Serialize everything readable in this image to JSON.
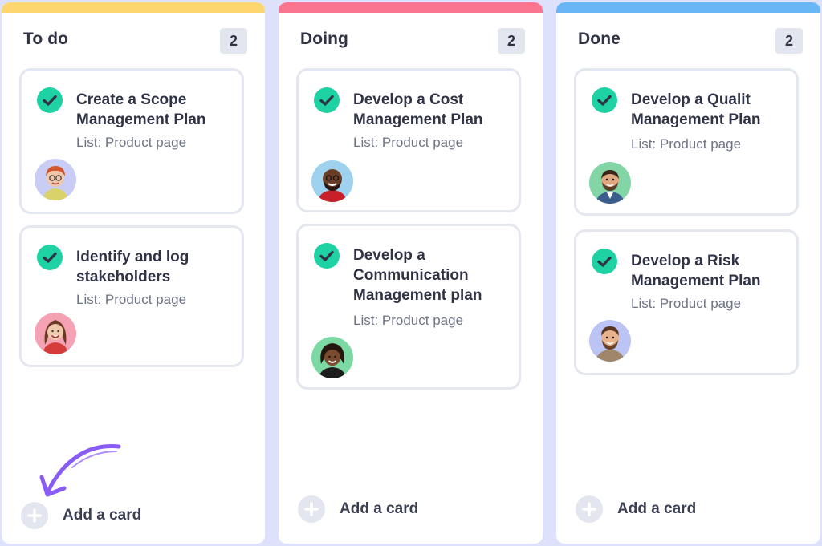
{
  "colors": {
    "todo_bar": "#fdd66f",
    "doing_bar": "#f9758f",
    "done_bar": "#68b6f6",
    "check_green": "#1ed2a4",
    "arrow_purple": "#8a5cf6"
  },
  "columns": [
    {
      "title": "To do",
      "count": "2",
      "add_label": "Add a card",
      "cards": [
        {
          "title": "Create a Scope Management Plan",
          "list": "List: Product page",
          "avatar": "avatar-red-hair-woman"
        },
        {
          "title": "Identify and log stakeholders",
          "list": "List: Product page",
          "avatar": "avatar-brown-hair-woman"
        }
      ]
    },
    {
      "title": "Doing",
      "count": "2",
      "add_label": "Add a card",
      "cards": [
        {
          "title": "Develop a Cost Management Plan",
          "list": "List: Product page",
          "avatar": "avatar-bearded-man"
        },
        {
          "title": "Develop a Communication Management plan",
          "list": "List: Product page",
          "avatar": "avatar-curly-hair-woman"
        }
      ]
    },
    {
      "title": "Done",
      "count": "2",
      "add_label": "Add a card",
      "cards": [
        {
          "title": "Develop a Qualit Management Plan",
          "list": "List: Product page",
          "avatar": "avatar-smiling-man"
        },
        {
          "title": "Develop a Risk Management Plan",
          "list": "List: Product page",
          "avatar": "avatar-beard-man"
        }
      ]
    }
  ]
}
